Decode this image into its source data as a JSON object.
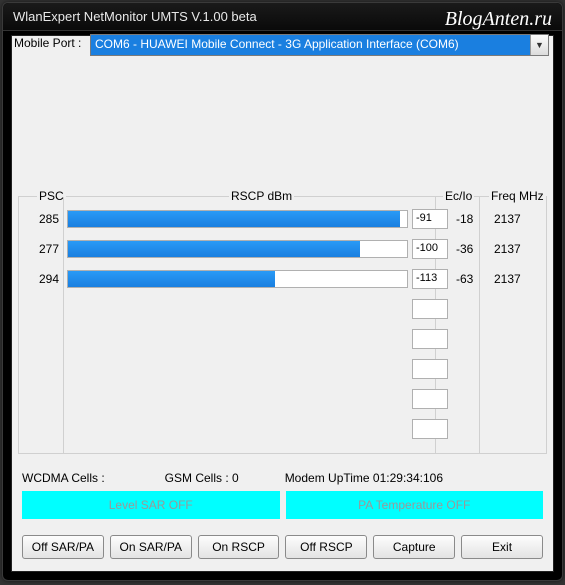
{
  "window": {
    "title": "WlanExpert NetMonitor UMTS V.1.00 beta",
    "watermark": "BlogAnten.ru"
  },
  "port": {
    "label": "Mobile Port :",
    "selected": "COM6 - HUAWEI Mobile Connect - 3G Application Interface (COM6)"
  },
  "headers": {
    "psc": "PSC",
    "rscp": "RSCP dBm",
    "ecio": "Ec/Io",
    "freq": "Freq MHz"
  },
  "rows": [
    {
      "psc": "285",
      "rscp": "-91",
      "bar_pct": 98,
      "ecio": "-18",
      "freq": "2137"
    },
    {
      "psc": "277",
      "rscp": "-100",
      "bar_pct": 86,
      "ecio": "-36",
      "freq": "2137"
    },
    {
      "psc": "294",
      "rscp": "-113",
      "bar_pct": 61,
      "ecio": "-63",
      "freq": "2137"
    },
    {
      "psc": "",
      "rscp": "",
      "bar_pct": 0,
      "ecio": "",
      "freq": ""
    },
    {
      "psc": "",
      "rscp": "",
      "bar_pct": 0,
      "ecio": "",
      "freq": ""
    },
    {
      "psc": "",
      "rscp": "",
      "bar_pct": 0,
      "ecio": "",
      "freq": ""
    },
    {
      "psc": "",
      "rscp": "",
      "bar_pct": 0,
      "ecio": "",
      "freq": ""
    },
    {
      "psc": "",
      "rscp": "",
      "bar_pct": 0,
      "ecio": "",
      "freq": ""
    }
  ],
  "status": {
    "wcdma": "WCDMA Cells :",
    "gsm": "GSM Cells : 0",
    "uptime": "Modem UpTime 01:29:34:106"
  },
  "cyan": {
    "sar": "Level SAR OFF",
    "pa": "PA Temperature OFF"
  },
  "buttons": {
    "offsarpa": "Off SAR/PA",
    "onsarpa": "On SAR/PA",
    "onrscp": "On RSCP",
    "offrscp": "Off RSCP",
    "capture": "Capture",
    "exit": "Exit"
  }
}
